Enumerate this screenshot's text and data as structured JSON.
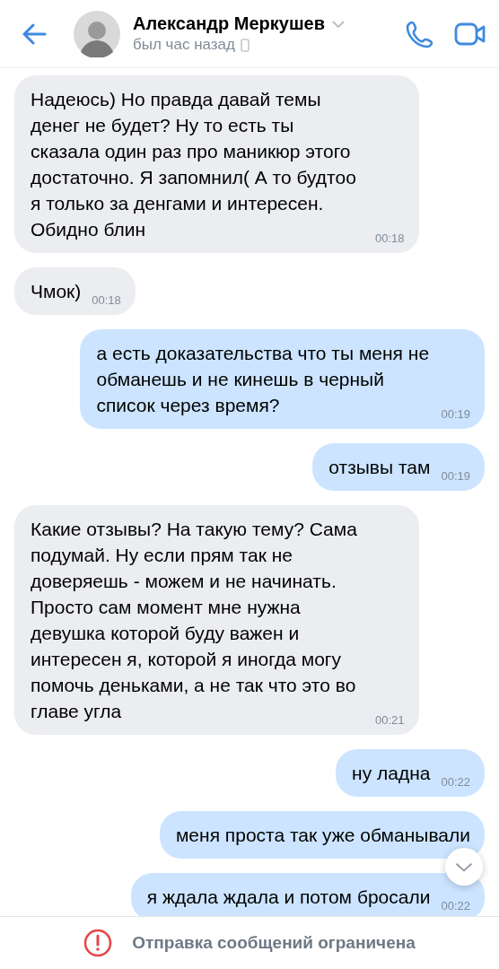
{
  "header": {
    "name": "Александр Меркушев",
    "status": "был час назад"
  },
  "messages": [
    {
      "kind": "incoming",
      "text": "Надеюсь) Но правда давай темы денег не будет? Ну то есть ты сказала один раз про маникюр этого достаточно. Я запомнил( А то будтоо я только за денгами и интересен. Обидно блин",
      "time": "00:18"
    },
    {
      "kind": "incoming",
      "text": "Чмок)",
      "time": "00:18"
    },
    {
      "kind": "outgoing",
      "text": "а есть доказательства что ты меня не обманешь и не кинешь в черный список через время?",
      "time": "00:19"
    },
    {
      "kind": "outgoing",
      "text": "отзывы там",
      "time": "00:19"
    },
    {
      "kind": "incoming",
      "text": "Какие отзывы? На такую тему? Сама подумай. Ну если прям так не доверяешь - можем и не начинать. Просто сам момент мне нужна девушка которой буду важен и интересен я, которой я иногда могу помочь деньками, а не так что это во главе угла",
      "time": "00:21"
    },
    {
      "kind": "outgoing",
      "text": "ну ладна",
      "time": "00:22"
    },
    {
      "kind": "outgoing",
      "text": "меня проста так уже обманывали"
    },
    {
      "kind": "outgoing",
      "text": "я ждала ждала и потом бросали",
      "time": "00:22"
    }
  ],
  "footer": {
    "notice": "Отправка сообщений ограничена"
  }
}
